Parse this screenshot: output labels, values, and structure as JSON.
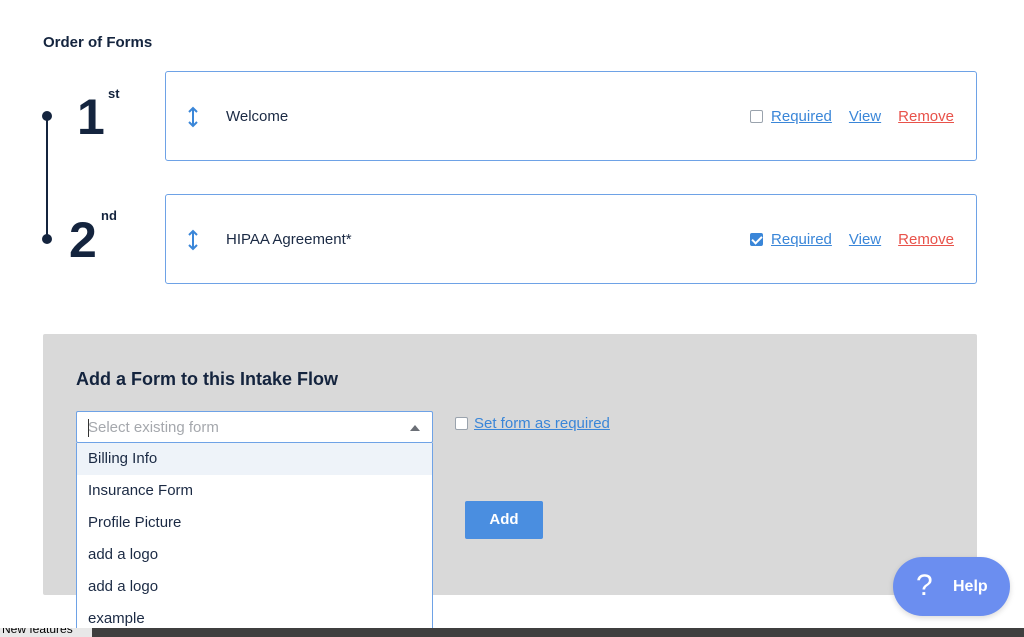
{
  "section": {
    "title": "Order of Forms"
  },
  "order": [
    {
      "number": "1",
      "suffix": "st"
    },
    {
      "number": "2",
      "suffix": "nd"
    }
  ],
  "forms": [
    {
      "name": "Welcome",
      "required_label": "Required",
      "required": false,
      "view_label": "View",
      "remove_label": "Remove"
    },
    {
      "name": "HIPAA Agreement*",
      "required_label": "Required",
      "required": true,
      "view_label": "View",
      "remove_label": "Remove"
    }
  ],
  "add_panel": {
    "title": "Add a Form to this Intake Flow",
    "select_placeholder": "Select existing form",
    "set_required_label": "Set form as required",
    "add_button": "Add"
  },
  "dropdown_options": [
    "Billing Info",
    "Insurance Form",
    "Profile Picture",
    "add a logo",
    "add a logo",
    "example"
  ],
  "bottom_bar": {
    "text": "New features"
  },
  "help": {
    "label": "Help",
    "icon_glyph": "?"
  },
  "colors": {
    "accent": "#3a86d8",
    "remove": "#e8524a",
    "help_bg": "#6b8ef0",
    "panel_bg": "#d9d9d9",
    "dark_text": "#14243e"
  }
}
